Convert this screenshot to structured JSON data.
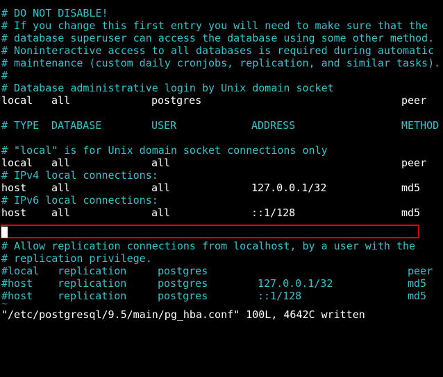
{
  "terminal": {
    "top_comments": [
      "# DO NOT DISABLE!",
      "# If you change this first entry you will need to make sure that the",
      "# database superuser can access the database using some other method.",
      "# Noninteractive access to all databases is required during automatic",
      "# maintenance (custom daily cronjobs, replication, and similar tasks).",
      "#",
      "# Database administrative login by Unix domain socket"
    ],
    "admin_entry": [
      "local",
      "all",
      "postgres",
      "peer"
    ],
    "header": [
      "# TYPE",
      "DATABASE",
      "USER",
      "ADDRESS",
      "METHOD"
    ],
    "local_comment": "# \"local\" is for Unix domain socket connections only",
    "local_entry": [
      "local",
      "all",
      "all",
      "peer"
    ],
    "ipv4_comment": "# IPv4 local connections:",
    "ipv4_entry": [
      "host",
      "all",
      "all",
      "127.0.0.1/32",
      "md5"
    ],
    "ipv6_comment": "# IPv6 local connections:",
    "ipv6_entry": [
      "host",
      "all",
      "all",
      "::1/128",
      "md5"
    ],
    "replication_comments": [
      "# Allow replication connections from localhost, by a user with the",
      "# replication privilege."
    ],
    "repl_local": [
      "#local",
      "replication",
      "postgres",
      "peer"
    ],
    "repl_host4": [
      "#host",
      "replication",
      "postgres",
      "127.0.0.1/32",
      "md5"
    ],
    "repl_host6": [
      "#host",
      "replication",
      "postgres",
      "::1/128",
      "md5"
    ],
    "tilde": "~",
    "status_line": "\"/etc/postgresql/9.5/main/pg_hba.conf\" 100L, 4642C written"
  },
  "colors": {
    "comment": "#2ec5cf",
    "text": "#ffffff",
    "background": "#000000",
    "highlight": "#e10000",
    "tilde": "#3b6fd6"
  }
}
